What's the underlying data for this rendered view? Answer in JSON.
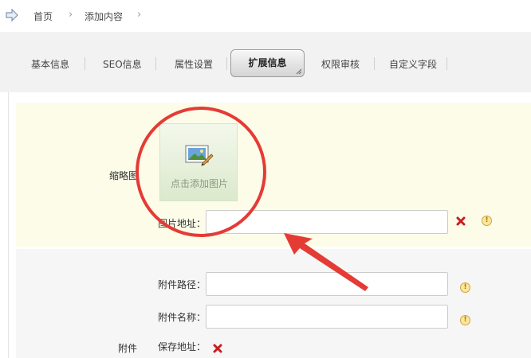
{
  "breadcrumb": {
    "home": "首页",
    "current": "添加内容",
    "separator": "›"
  },
  "tabs": [
    {
      "label": "基本信息"
    },
    {
      "label": "SEO信息"
    },
    {
      "label": "属性设置"
    },
    {
      "label": "扩展信息",
      "active": true
    },
    {
      "label": "权限审核"
    },
    {
      "label": "自定义字段"
    }
  ],
  "thumbnail": {
    "label": "缩略图",
    "add_text": "点击添加图片",
    "url_label": "图片地址：",
    "url_value": ""
  },
  "attachment": {
    "label": "附件",
    "path_label": "附件路径：",
    "path_value": "",
    "name_label": "附件名称：",
    "name_value": "",
    "save_label": "保存地址："
  },
  "icons": {
    "delete": "x-icon",
    "warning": "warning-icon",
    "home": "home-arrow-icon"
  },
  "colors": {
    "annotation": "#e53b35",
    "delete": "#c81e1e",
    "warning": "#f2c94c",
    "yellow_panel": "#fcfce9"
  },
  "warning_glyph": "!"
}
